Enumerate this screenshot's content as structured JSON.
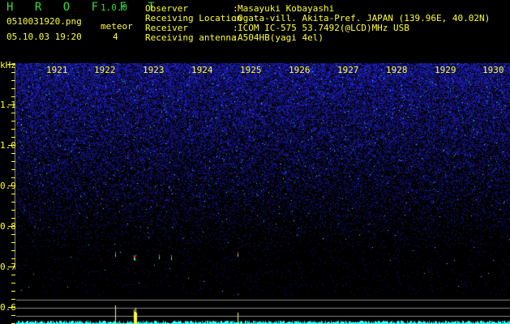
{
  "header": {
    "app_title": "H R O F F T",
    "version": "1.0.0",
    "filename": "0510031920.png",
    "datetime": "05.10.03 19:20",
    "meteor_label": "meteor",
    "meteor_count": "4",
    "info": [
      {
        "label": "Observer",
        "value": "Masayuki Kobayashi"
      },
      {
        "label": "Receiving Location",
        "value": "Ogata-vill. Akita-Pref. JAPAN (139.96E, 40.02N)"
      },
      {
        "label": "Receiver",
        "value": "ICOM IC-575 53.7492(@LCD)MHz USB"
      },
      {
        "label": "Receiving antenna",
        "value": "A504HB(yagi 4el)"
      }
    ]
  },
  "axis": {
    "y_unit": "kHz",
    "y_labels": [
      "1.1",
      "1.0",
      "0.9",
      "0.8",
      "0.7",
      "0.6"
    ],
    "x_labels": [
      "1921",
      "1922",
      "1923",
      "1924",
      "1925",
      "1926",
      "1927",
      "1928",
      "1929",
      "1930"
    ]
  },
  "colors": {
    "text": "#ffff33",
    "title": "#33dd33",
    "noise": "#1a1acc",
    "echo": "#ff3333",
    "strip": "#33ffff"
  }
}
